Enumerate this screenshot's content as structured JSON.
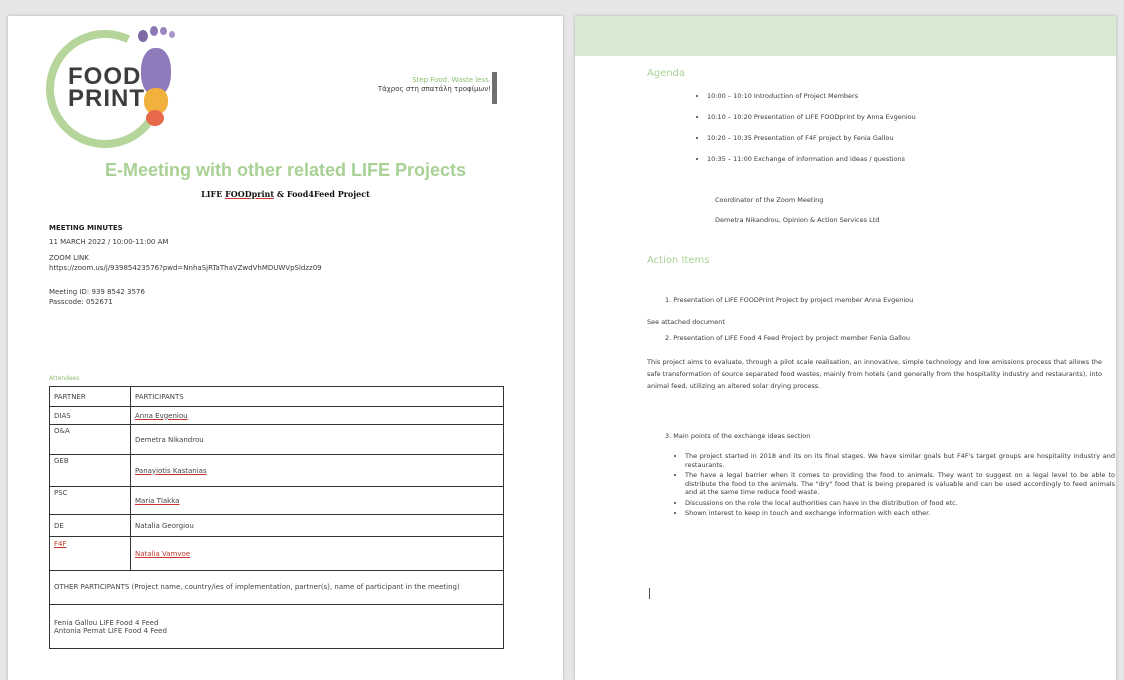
{
  "page1": {
    "logo": {
      "line1": "FOOD",
      "line2": "PRINT"
    },
    "quote": {
      "line1": "Step Food. Waste less.",
      "line2": "Τάχρος στη σπατάλη τροφίμων!"
    },
    "title": "E-Meeting with other related LIFE Projects",
    "subtitle": {
      "part1": "LIFE ",
      "part2": "FOODprint",
      "part3": " & Food4Feed Project"
    },
    "minutes_heading": "MEETING MINUTES",
    "date": "11 MARCH 2022 / 10:00-11:00 AM",
    "zoom_label": "ZOOM LINK",
    "zoom_url": "https://zoom.us/j/93985423576?pwd=NnhaSjRTaThaVZwdVhMDUWVpSldzz09",
    "meeting_id": "Meeting ID: 939 8542 3576",
    "passcode": "Passcode: 052671",
    "attendees_label": "Attendees",
    "table": {
      "header": [
        "PARTNER",
        "PARTICIPANTS"
      ],
      "rows": [
        [
          "DIAS",
          "Anna Evgeniou"
        ],
        [
          "O&A",
          "Demetra Nikandrou"
        ],
        [
          "GEB",
          "Panayiotis Kastanias"
        ],
        [
          "PSC",
          "Maria Tlakka"
        ],
        [
          "DE",
          "Natalia Georgiou"
        ],
        [
          "F4F",
          "Natalia Vamvoe"
        ]
      ],
      "other_participants": "OTHER PARTICIPANTS (Project name, country/ies of implementation, partner(s), name of participant in the meeting)",
      "other_line1": "Fenia Gallou LIFE Food 4 Feed",
      "other_line2": "Antonia Pernat LIFE Food 4 Feed"
    }
  },
  "page2": {
    "agenda_heading": "Agenda",
    "agenda": [
      "10:00 – 10:10 Introduction of Project Members",
      "10:10 – 10:20 Presentation of LIFE FOODprint by Anna Evgeniou",
      "10:20 – 10:35 Presentation of F4F project by Fenia Gallou",
      "10:35 – 11:00 Exchange of information and ideas / questions"
    ],
    "coordinator_label": "Coordinator of the Zoom Meeting",
    "coordinator_name": "Demetra Nikandrou, Opinion & Action Services Ltd",
    "action_heading": "Action Items",
    "item1": "1.   Presentation of LIFE FOODPrint Project by project member Anna Evgeniou",
    "see_attached": "See attached document",
    "item2": "2.   Presentation of LIFE Food 4 Feed Project by project member Fenia Gallou",
    "paragraph": "This project aims to evaluate, through a pilot scale realisation, an innovative, simple technology and low emissions process that allows the safe transformation of source separated food wastes, mainly from hotels (and generally from the hospitality industry and restaurants), into animal feed, utilizing an altered solar drying process.",
    "item3": "3.   Main points of the exchange ideas section",
    "bullets": [
      "The project started in 2018 and its on its final stages. We have similar goals but F4F's target groups are hospitality industry and restaurants.",
      "The have a legal barrier when it comes to providing the food to animals. They want to suggest on a legal level to be able to distribute the food to the animals. The \"dry\" food that is being prepared is valuable and can be used accordingly to feed animals and at the same time reduce food waste.",
      "Discussions on the role the local authorities can have in the distribution of food etc.",
      "Shown interest to keep in touch and exchange information with each other."
    ]
  }
}
